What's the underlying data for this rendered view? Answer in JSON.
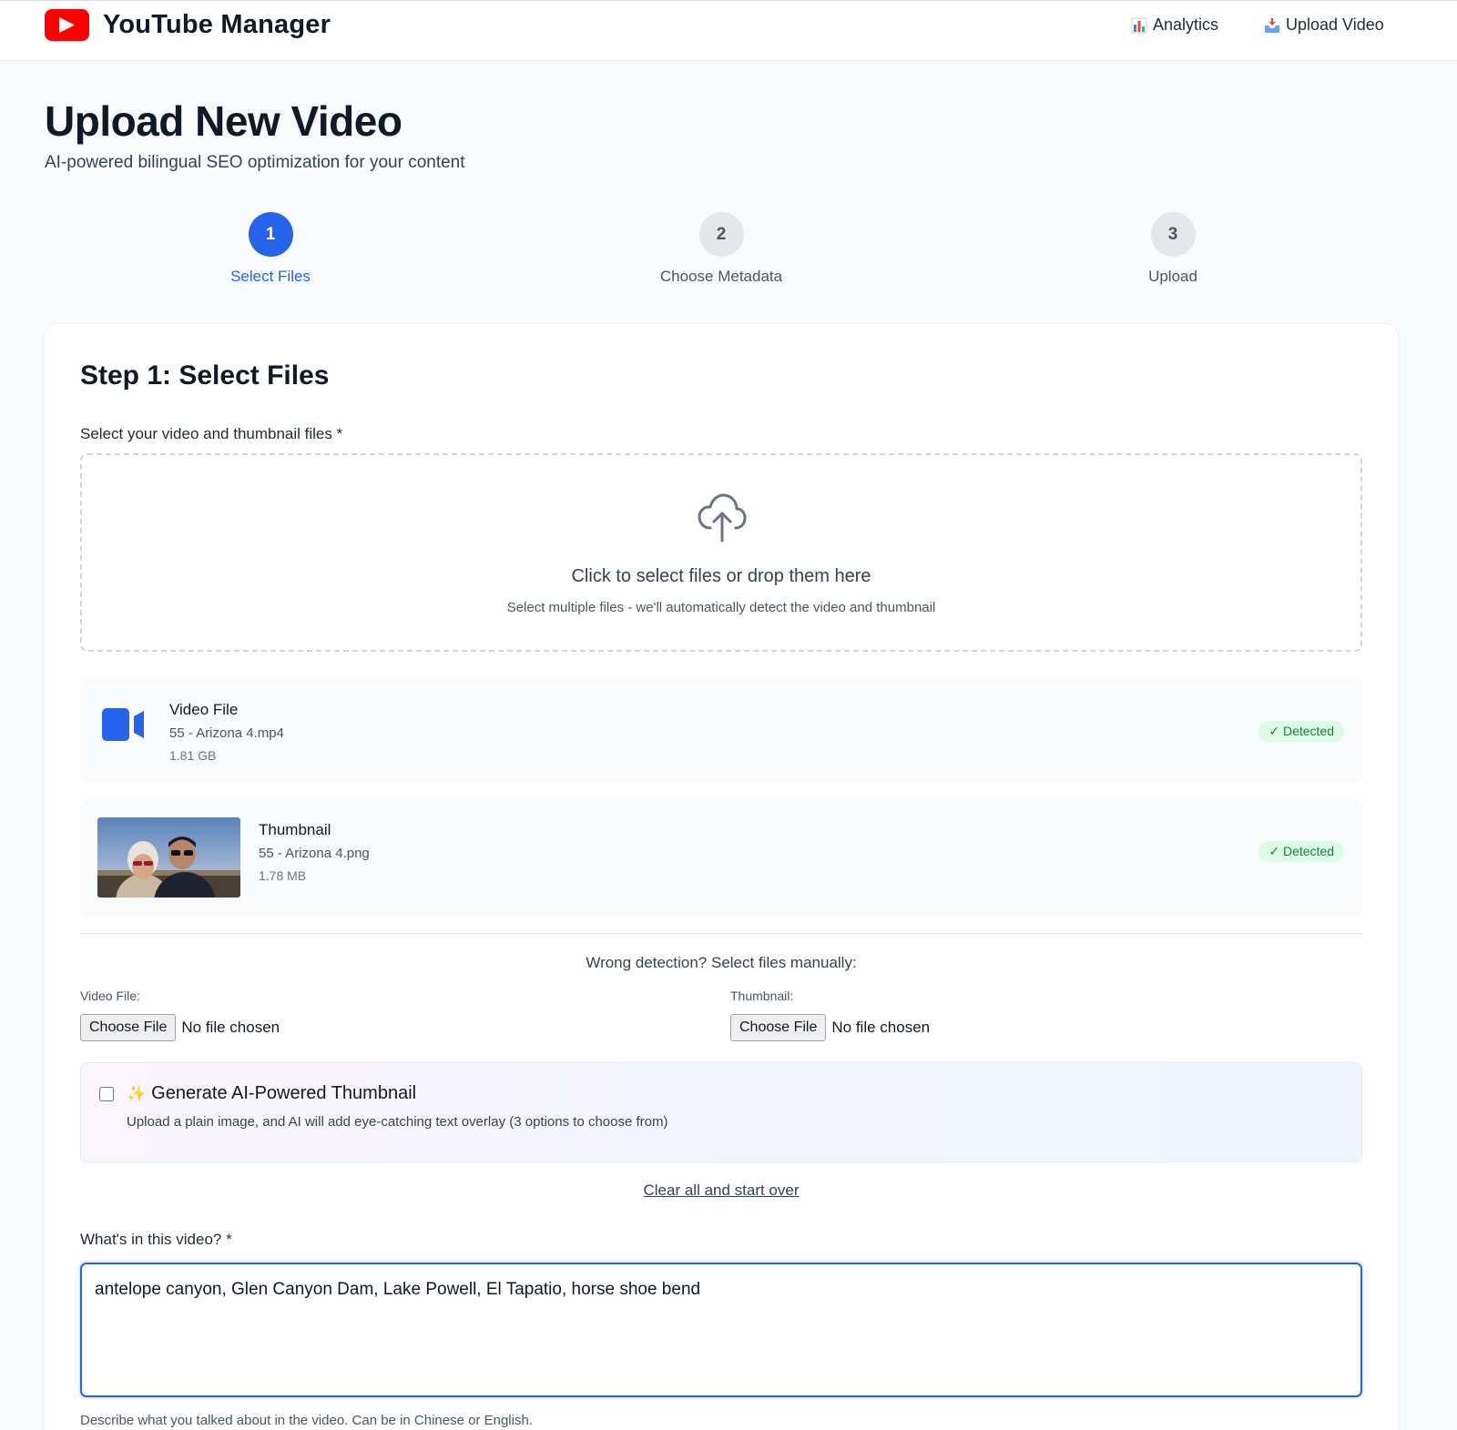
{
  "header": {
    "brand": "YouTube Manager",
    "nav": [
      {
        "label": "Analytics",
        "icon": "bar-chart-icon"
      },
      {
        "label": "Upload Video",
        "icon": "inbox-tray-icon"
      }
    ]
  },
  "page": {
    "title": "Upload New Video",
    "subtitle": "AI-powered bilingual SEO optimization for your content"
  },
  "steps": [
    {
      "number": "1",
      "label": "Select Files",
      "state": "active"
    },
    {
      "number": "2",
      "label": "Choose Metadata",
      "state": "inactive"
    },
    {
      "number": "3",
      "label": "Upload",
      "state": "inactive"
    }
  ],
  "card": {
    "title": "Step 1: Select Files",
    "files_label": "Select your video and thumbnail files *",
    "dropzone": {
      "title": "Click to select files or drop them here",
      "subtitle": "Select multiple files - we'll automatically detect the video and thumbnail"
    },
    "video_file": {
      "title": "Video File",
      "name": "55 - Arizona 4.mp4",
      "size": "1.81 GB",
      "badge": "✓ Detected"
    },
    "thumbnail_file": {
      "title": "Thumbnail",
      "name": "55 - Arizona 4.png",
      "size": "1.78 MB",
      "badge": "✓ Detected"
    },
    "manual": {
      "title": "Wrong detection? Select files manually:",
      "video_label": "Video File:",
      "thumb_label": "Thumbnail:",
      "button_label": "Choose File",
      "no_file": "No file chosen"
    },
    "ai_thumbnail": {
      "checked": false,
      "title": "Generate AI-Powered Thumbnail",
      "description": "Upload a plain image, and AI will add eye-catching text overlay (3 options to choose from)"
    },
    "clear_link": "Clear all and start over",
    "description_label": "What's in this video? *",
    "description_value": "antelope canyon, Glen Canyon Dam, Lake Powell, El Tapatio, horse shoe bend",
    "description_hint": "Describe what you talked about in the video. Can be in Chinese or English."
  },
  "colors": {
    "accent": "#2563eb",
    "brand_red": "#ff0000",
    "success_bg": "#dcfce7",
    "success_text": "#15803d"
  }
}
